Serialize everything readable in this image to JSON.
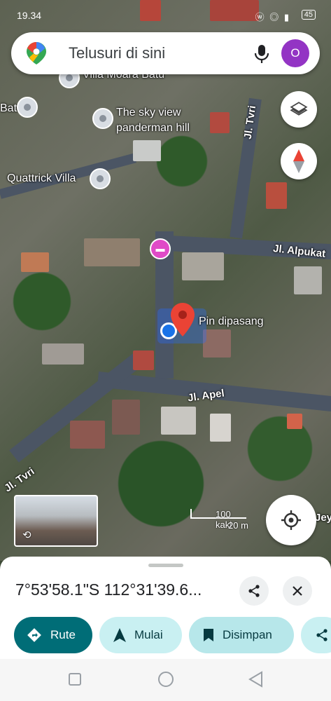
{
  "status_bar": {
    "time": "19.34",
    "icons": "ⓦ ◎ ▮",
    "battery": "45"
  },
  "search": {
    "placeholder": "Telusuri di sini",
    "avatar_letter": "O"
  },
  "map": {
    "pois": [
      {
        "label": "Villa Moara Batu"
      },
      {
        "label": "Batu"
      },
      {
        "label": "The sky view\npanderman hill"
      },
      {
        "label": "Quattrick Villa"
      }
    ],
    "streets": [
      "Jl. Tvri",
      "Jl. Alpukat",
      "Jl. Apel",
      "Jl. Tvri",
      "Jeyn"
    ],
    "pin_label": "Pin dipasang",
    "scale": {
      "imperial": "100 kaki",
      "metric": "20 m"
    }
  },
  "sheet": {
    "coordinates": "7°53'58.1\"S 112°31'39.6...",
    "chips": [
      {
        "label": "Rute",
        "icon": "directions-icon"
      },
      {
        "label": "Mulai",
        "icon": "navigation-icon"
      },
      {
        "label": "Disimpan",
        "icon": "bookmark-icon"
      },
      {
        "label": "",
        "icon": "share-icon"
      }
    ]
  },
  "colors": {
    "accent_teal": "#006d77",
    "chip_teal": "#c9f0f2",
    "maps_red": "#ea4335",
    "avatar": "#9334c4"
  }
}
